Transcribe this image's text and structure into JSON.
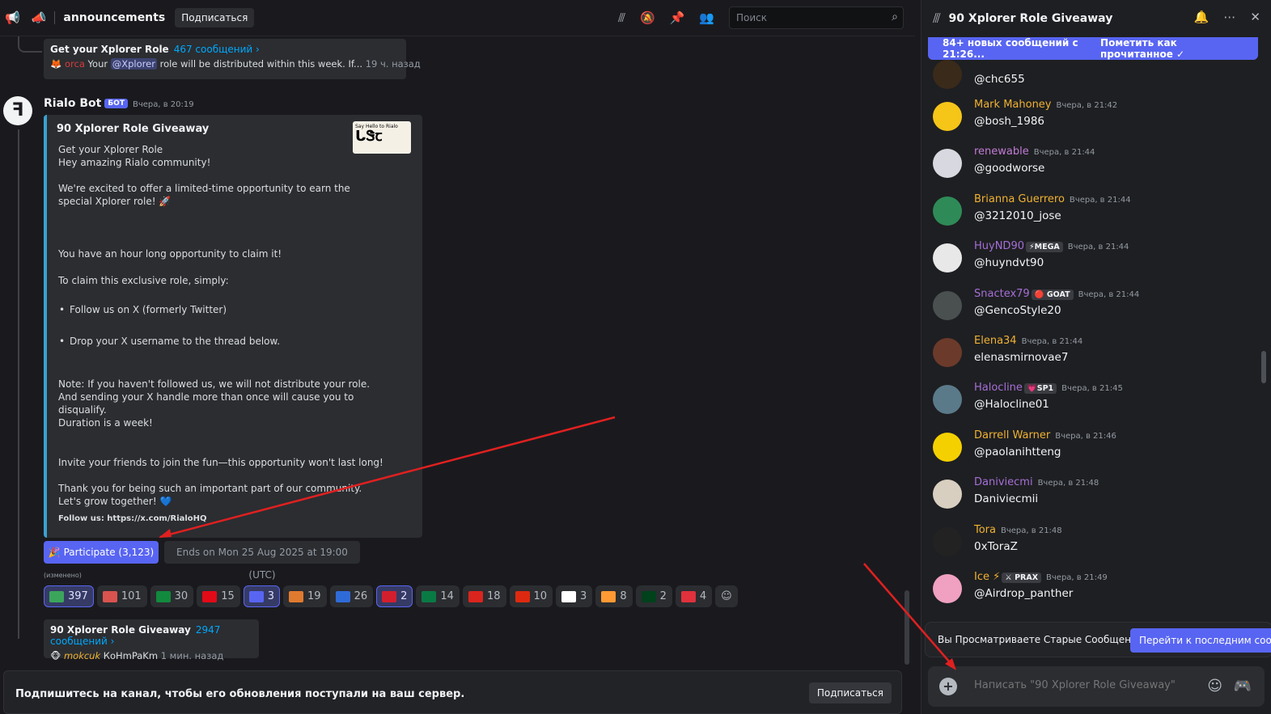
{
  "header": {
    "channel": "announcements",
    "subscribe": "Подписаться",
    "search_placeholder": "Поиск"
  },
  "thread_top": {
    "title": "Get your Xplorer Role",
    "count": "467 сообщений ›",
    "author": "orca",
    "pre": "Your",
    "mention": "@Xplorer",
    "post": "role will be distributed within this week. If...",
    "time": "19 ч. назад"
  },
  "message": {
    "author": "Rialo Bot",
    "bot_tag": "БОТ",
    "time": "Вчера, в 20:19",
    "embed": {
      "title": "90 Xplorer Role Giveaway",
      "thumb_text": "Say Hello to Rialo",
      "line1": "Get your Xplorer Role",
      "line2": "Hey amazing Rialo community!",
      "line3": "We're excited to offer a limited-time opportunity to earn the",
      "line4": "special Xplorer role! 🚀",
      "line5": "You have an hour long opportunity to claim it!",
      "line6": "To claim this exclusive role, simply:",
      "bullet1": "Follow us on X (formerly Twitter)",
      "bullet2": "Drop your X username to the thread below.",
      "line7": "Note: If you haven't followed us, we will not distribute your role.",
      "line8": "And sending your X handle more than once will cause you to",
      "line9": "disqualify.",
      "line10": "Duration is a week!",
      "line11": "Invite your friends to join the fun—this opportunity won't last long!",
      "line12": "Thank you for being such an important part of our community.",
      "line13": "Let's grow together! 💙",
      "footer": "Follow us: https://x.com/RialoHQ"
    },
    "participate": "🎉 Participate (3,123)",
    "ends": "Ends on Mon 25 Aug 2025 at 19:00 (UTC)",
    "edited": "(изменено)"
  },
  "reactions": [
    {
      "emoji": "✅",
      "count": "397",
      "active": true,
      "color": "#3ba55c"
    },
    {
      "emoji": "🪁",
      "count": "101",
      "active": false,
      "color": "#d9534f"
    },
    {
      "emoji": "🇳🇬",
      "count": "30",
      "active": false,
      "color": "#128a3e"
    },
    {
      "emoji": "🇹🇷",
      "count": "15",
      "active": false,
      "color": "#e30a17"
    },
    {
      "emoji": "🚀",
      "count": "3",
      "active": true,
      "color": "#5865f2"
    },
    {
      "emoji": "🦞",
      "count": "19",
      "active": false,
      "color": "#e07a2f"
    },
    {
      "emoji": "🇺🇦",
      "count": "26",
      "active": false,
      "color": "#2f6bd8"
    },
    {
      "emoji": "🇮🇩",
      "count": "2",
      "active": true,
      "color": "#d21f2e"
    },
    {
      "emoji": "🇧🇩",
      "count": "14",
      "active": false,
      "color": "#0a7a45"
    },
    {
      "emoji": "🇻🇳",
      "count": "18",
      "active": false,
      "color": "#da251d"
    },
    {
      "emoji": "🇨🇳",
      "count": "10",
      "active": false,
      "color": "#de2910"
    },
    {
      "emoji": "🇰🇷",
      "count": "3",
      "active": false,
      "color": "#ffffff"
    },
    {
      "emoji": "🇮🇳",
      "count": "8",
      "active": false,
      "color": "#ff9933"
    },
    {
      "emoji": "🇵🇰",
      "count": "2",
      "active": false,
      "color": "#01411c"
    },
    {
      "emoji": "💯",
      "count": "4",
      "active": false,
      "color": "#e0313c"
    }
  ],
  "thread_bottom": {
    "title": "90 Xplorer Role Giveaway",
    "count": "2947 сообщений ›",
    "author": "mokcuk",
    "text": "КоНmPaKm",
    "time": "1 мин. назад"
  },
  "subscribe_bar": {
    "text": "Подпишитесь на канал, чтобы его обновления поступали на ваш сервер.",
    "button": "Подписаться"
  },
  "thread_panel": {
    "title": "90 Xplorer Role Giveaway",
    "new_msgs": "84+ новых сообщений с 21:26...",
    "mark_read": "Пометить как прочитанное",
    "messages": [
      {
        "name": "",
        "badge": "",
        "time": "",
        "text": "@chc655",
        "color": "#f0b232",
        "avatar": "#3a2a1a"
      },
      {
        "name": "Mark Mahoney",
        "badge": "",
        "time": "Вчера, в 21:42",
        "text": "@bosh_1986",
        "color": "#f0b232",
        "avatar": "#f5c518"
      },
      {
        "name": "renewable",
        "badge": "",
        "time": "Вчера, в 21:44",
        "text": "@goodworse",
        "color": "#c27cd6",
        "avatar": "#d8d8e0"
      },
      {
        "name": "Brianna Guerrero",
        "badge": "",
        "time": "Вчера, в 21:44",
        "text": "@3212010_jose",
        "color": "#f0b232",
        "avatar": "#2e8b57"
      },
      {
        "name": "HuyND90",
        "badge": "⚡MEGA",
        "time": "Вчера, в 21:44",
        "text": "@huyndvt90",
        "color": "#a56fd6",
        "avatar": "#e8e8e8"
      },
      {
        "name": "Snactex79",
        "badge": "🔴 GOAT",
        "time": "Вчера, в 21:44",
        "text": "@GencoStyle20",
        "color": "#a56fd6",
        "avatar": "#4a5050"
      },
      {
        "name": "Elena34",
        "badge": "",
        "time": "Вчера, в 21:44",
        "text": "elenasmirnovae7",
        "color": "#f0b232",
        "avatar": "#6b3a2a"
      },
      {
        "name": "Halocline",
        "badge": "💗SP1",
        "time": "Вчера, в 21:45",
        "text": "@Halocline01",
        "color": "#a56fd6",
        "avatar": "#5a7a8a"
      },
      {
        "name": "Darrell Warner",
        "badge": "",
        "time": "Вчера, в 21:46",
        "text": "@paolanihtteng",
        "color": "#f0b232",
        "avatar": "#f5d000"
      },
      {
        "name": "Daniviecmi",
        "badge": "",
        "time": "Вчера, в 21:48",
        "text": "Daniviecmii",
        "color": "#a56fd6",
        "avatar": "#d8cfc0"
      },
      {
        "name": "Tora",
        "badge": "",
        "time": "Вчера, в 21:48",
        "text": "0xToraZ",
        "color": "#f0b232",
        "avatar": "#222"
      },
      {
        "name": "Ice ⚡",
        "badge": "⚔ PRAX",
        "time": "Вчера, в 21:49",
        "text": "@Airdrop_panther",
        "color": "#f0b232",
        "avatar": "#f0a0c0"
      }
    ],
    "old_text": "Вы Просматриваете Старые Сообщения",
    "old_button": "Перейти к последним сообщениям",
    "composer_placeholder": "Написать \"90 Xplorer Role Giveaway\""
  }
}
